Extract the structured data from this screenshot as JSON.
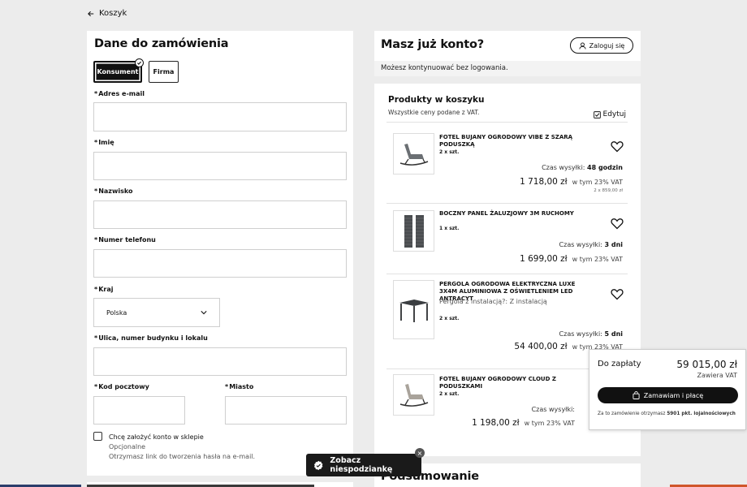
{
  "nav": {
    "back_label": "Koszyk"
  },
  "form": {
    "title": "Dane do zamówienia",
    "customer_types": [
      "Konsument",
      "Firma"
    ],
    "selected_type": "Konsument",
    "fields": {
      "email_label": "Adres e-mail",
      "first_name_label": "Imię",
      "last_name_label": "Nazwisko",
      "phone_label": "Numer telefonu",
      "country_label": "Kraj",
      "country_value": "Polska",
      "street_label": "Ulica, numer budynku i lokalu",
      "postal_label": "Kod pocztowy",
      "city_label": "Miasto",
      "required_mark": "*"
    },
    "create_account": {
      "label": "Chcę założyć konto w sklepie",
      "optional": "Opcjonalne",
      "hint": "Otrzymasz link do tworzenia hasła na e-mail."
    }
  },
  "account": {
    "title": "Masz już konto?",
    "login_label": "Zaloguj się",
    "note": "Możesz kontynuować bez logowania."
  },
  "cart": {
    "title": "Produkty w koszyku",
    "subtitle": "Wszystkie ceny podane z VAT.",
    "edit_label": "Edytuj",
    "items": [
      {
        "name": "FOTEL BUJANY OGRODOWY VIBE Z SZARĄ PODUSZKĄ",
        "qty": "2 x szt.",
        "ship_label": "Czas wysyłki:",
        "ship_value": "48 godzin",
        "price": "1 718,00 zł",
        "vat": "w tym 23% VAT",
        "unit": "2 x 859,00 zł"
      },
      {
        "name": "BOCZNY PANEL ŻALUZJOWY 3M RUCHOMY",
        "qty": "1 x szt.",
        "ship_label": "Czas wysyłki:",
        "ship_value": "3 dni",
        "price": "1 699,00 zł",
        "vat": "w tym 23% VAT"
      },
      {
        "name": "PERGOLA OGRODOWA ELEKTRYCZNA LUXE 3X4M ALUMINIOWA Z OŚWIETLENIEM LED ANTRACYT",
        "option_label": "Pergola z instalacją?:",
        "option_value": "Z instalacją",
        "qty": "2 x szt.",
        "ship_label": "Czas wysyłki:",
        "ship_value": "5 dni",
        "price": "54 400,00 zł",
        "vat": "w tym 23% VAT"
      },
      {
        "name": "FOTEL BUJANY OGRODOWY CLOUD Z PODUSZKAMI",
        "qty": "2 x szt.",
        "ship_label": "Czas wysyłki:",
        "price": "1 198,00 zł",
        "vat": "w tym 23% VAT"
      }
    ]
  },
  "payment": {
    "label": "Do zapłaty",
    "total": "59 015,00 zł",
    "vat_note": "Zawiera VAT",
    "order_button": "Zamawiam i płacę",
    "loyalty_text": "Za to zamówienie otrzymasz",
    "loyalty_points": "5901 pkt. lojalnościowych"
  },
  "promo": {
    "label": "Zobacz niespodziankę",
    "close": "×"
  },
  "summary": {
    "title": "Podsumowanie"
  },
  "colors": {
    "primary": "#111111",
    "background": "#ececec",
    "panel": "#ffffff",
    "note_bg": "#f3f3f3"
  }
}
